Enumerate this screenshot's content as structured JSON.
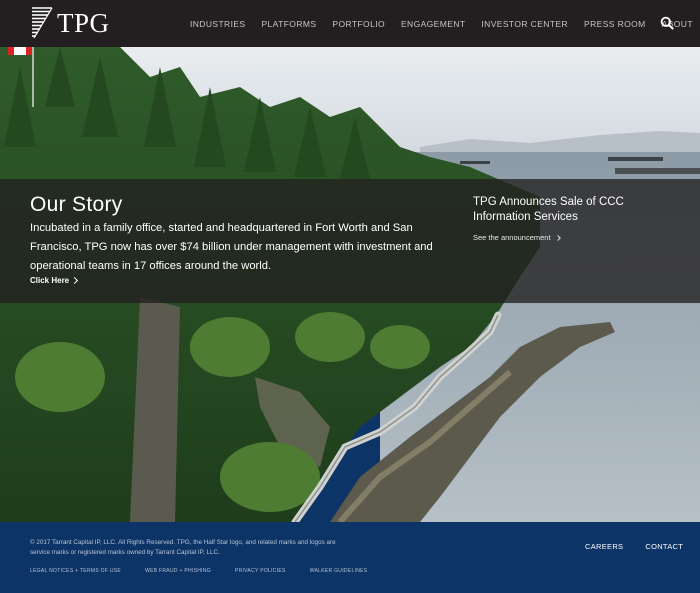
{
  "brand": {
    "name": "TPG"
  },
  "nav": {
    "items": [
      "INDUSTRIES",
      "PLATFORMS",
      "PORTFOLIO",
      "ENGAGEMENT",
      "INVESTOR CENTER",
      "PRESS ROOM",
      "ABOUT"
    ],
    "search_icon": "search-icon"
  },
  "hero": {
    "title": "Our Story",
    "body": "Incubated in a family office, started and headquartered in Fort Worth and San Francisco, TPG now has over $74 billion under management with investment and operational teams in 17 offices around the world.",
    "cta": "Click Here",
    "announcement": {
      "title": "TPG Announces Sale of CCC Information Services",
      "link": "See the announcement"
    }
  },
  "footer": {
    "copyright": "© 2017 Tarrant Capital IP, LLC. All Rights Reserved. TPG, the Half Star logo, and related marks and logos are service marks or registered marks owned by Tarrant Capital IP, LLC.",
    "links": [
      "LEGAL NOTICES + TERMS OF USE",
      "WEB FRAUD + PHISHING",
      "PRIVACY POLICIES",
      "WALKER GUIDELINES"
    ],
    "nav": [
      "CAREERS",
      "CONTACT"
    ]
  },
  "colors": {
    "header_bg": "#231f20",
    "footer_bg": "#0c3467",
    "overlay": "rgba(34,32,32,0.78)"
  }
}
